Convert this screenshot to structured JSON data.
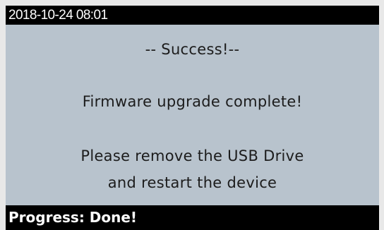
{
  "status_bar": {
    "datetime": "2018-10-24 08:01"
  },
  "messages": {
    "title": "-- Success!--",
    "complete": "Firmware upgrade complete!",
    "instruction_line1": "Please remove the USB Drive",
    "instruction_line2": "and restart the device"
  },
  "progress_bar": {
    "text": "Progress: Done!"
  },
  "colors": {
    "screen_background": "#b8c3cd",
    "bar_background": "#000000",
    "bar_text": "#ffffff",
    "message_text": "#1c1c1c",
    "outer_background": "#e8e8e8"
  }
}
